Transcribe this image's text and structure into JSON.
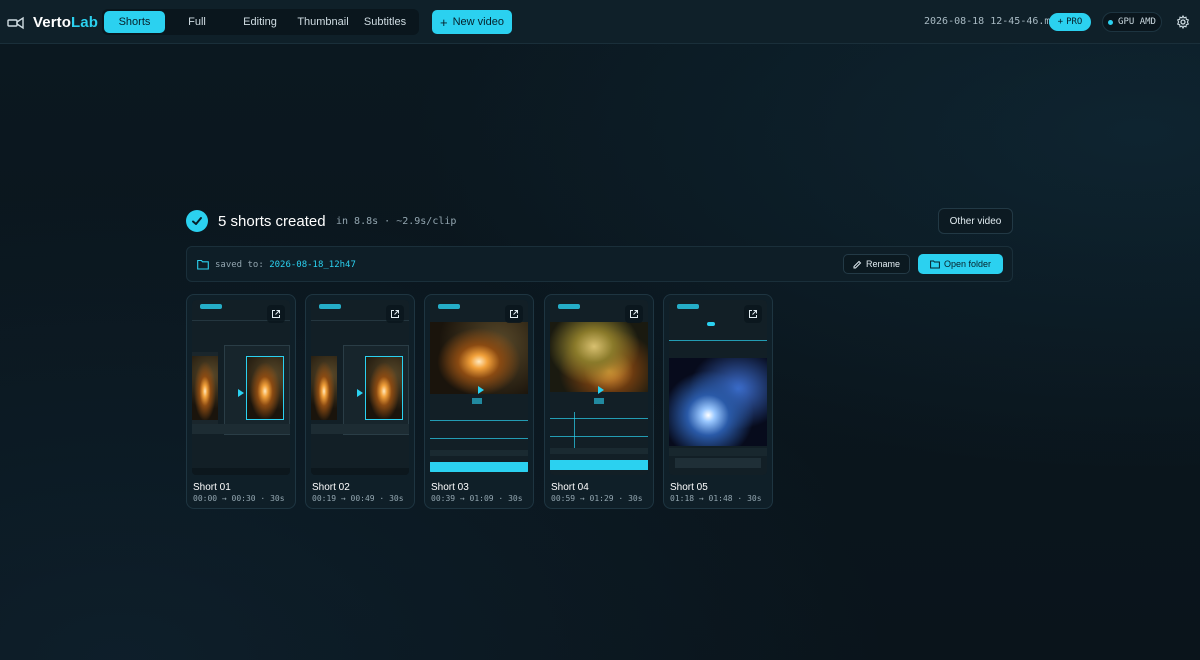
{
  "app": {
    "name_main": "Verto",
    "name_accent": "Lab"
  },
  "tabs": [
    {
      "label": "Shorts",
      "active": true
    },
    {
      "label": "Full",
      "active": false
    },
    {
      "label": "Editing",
      "active": false
    },
    {
      "label": "Thumbnail",
      "active": false
    },
    {
      "label": "Subtitles",
      "active": false
    }
  ],
  "toolbar": {
    "new_video_label": "New video",
    "filename": "2026-08-18 12-45-46.mp4",
    "pro_label": "PRO",
    "gpu_label": "GPU AMD"
  },
  "result": {
    "title": "5 shorts created",
    "meta": "in 8.8s · ~2.9s/clip",
    "other_video_label": "Other video"
  },
  "saved": {
    "label": "saved to:",
    "path": "2026-08-18_12h47",
    "rename_label": "Rename",
    "open_folder_label": "Open folder"
  },
  "shorts": [
    {
      "title": "Short 01",
      "meta": "00:00 → 00:30 · 30s"
    },
    {
      "title": "Short 02",
      "meta": "00:19 → 00:49 · 30s"
    },
    {
      "title": "Short 03",
      "meta": "00:39 → 01:09 · 30s"
    },
    {
      "title": "Short 04",
      "meta": "00:59 → 01:29 · 30s"
    },
    {
      "title": "Short 05",
      "meta": "01:18 → 01:48 · 30s"
    }
  ],
  "colors": {
    "accent": "#2bd1f0",
    "background": "#0b1820"
  }
}
